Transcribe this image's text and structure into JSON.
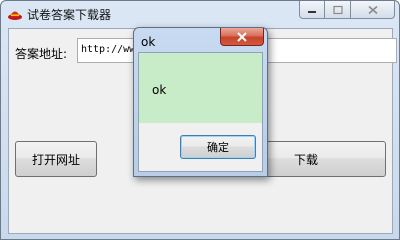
{
  "window": {
    "title": "试卷答案下载器"
  },
  "form": {
    "url_label": "答案地址:",
    "url_value": "http://www.",
    "open_button": "打开网址",
    "download_button": "下载"
  },
  "dialog": {
    "title": "ok",
    "message": "ok",
    "confirm_button": "确定"
  },
  "colors": {
    "message_background": "#c8ecc8",
    "close_button": "#c7432c"
  },
  "icons": {
    "app": "red-hat-icon",
    "minimize": "minimize-icon",
    "maximize": "maximize-icon",
    "close": "close-icon"
  }
}
